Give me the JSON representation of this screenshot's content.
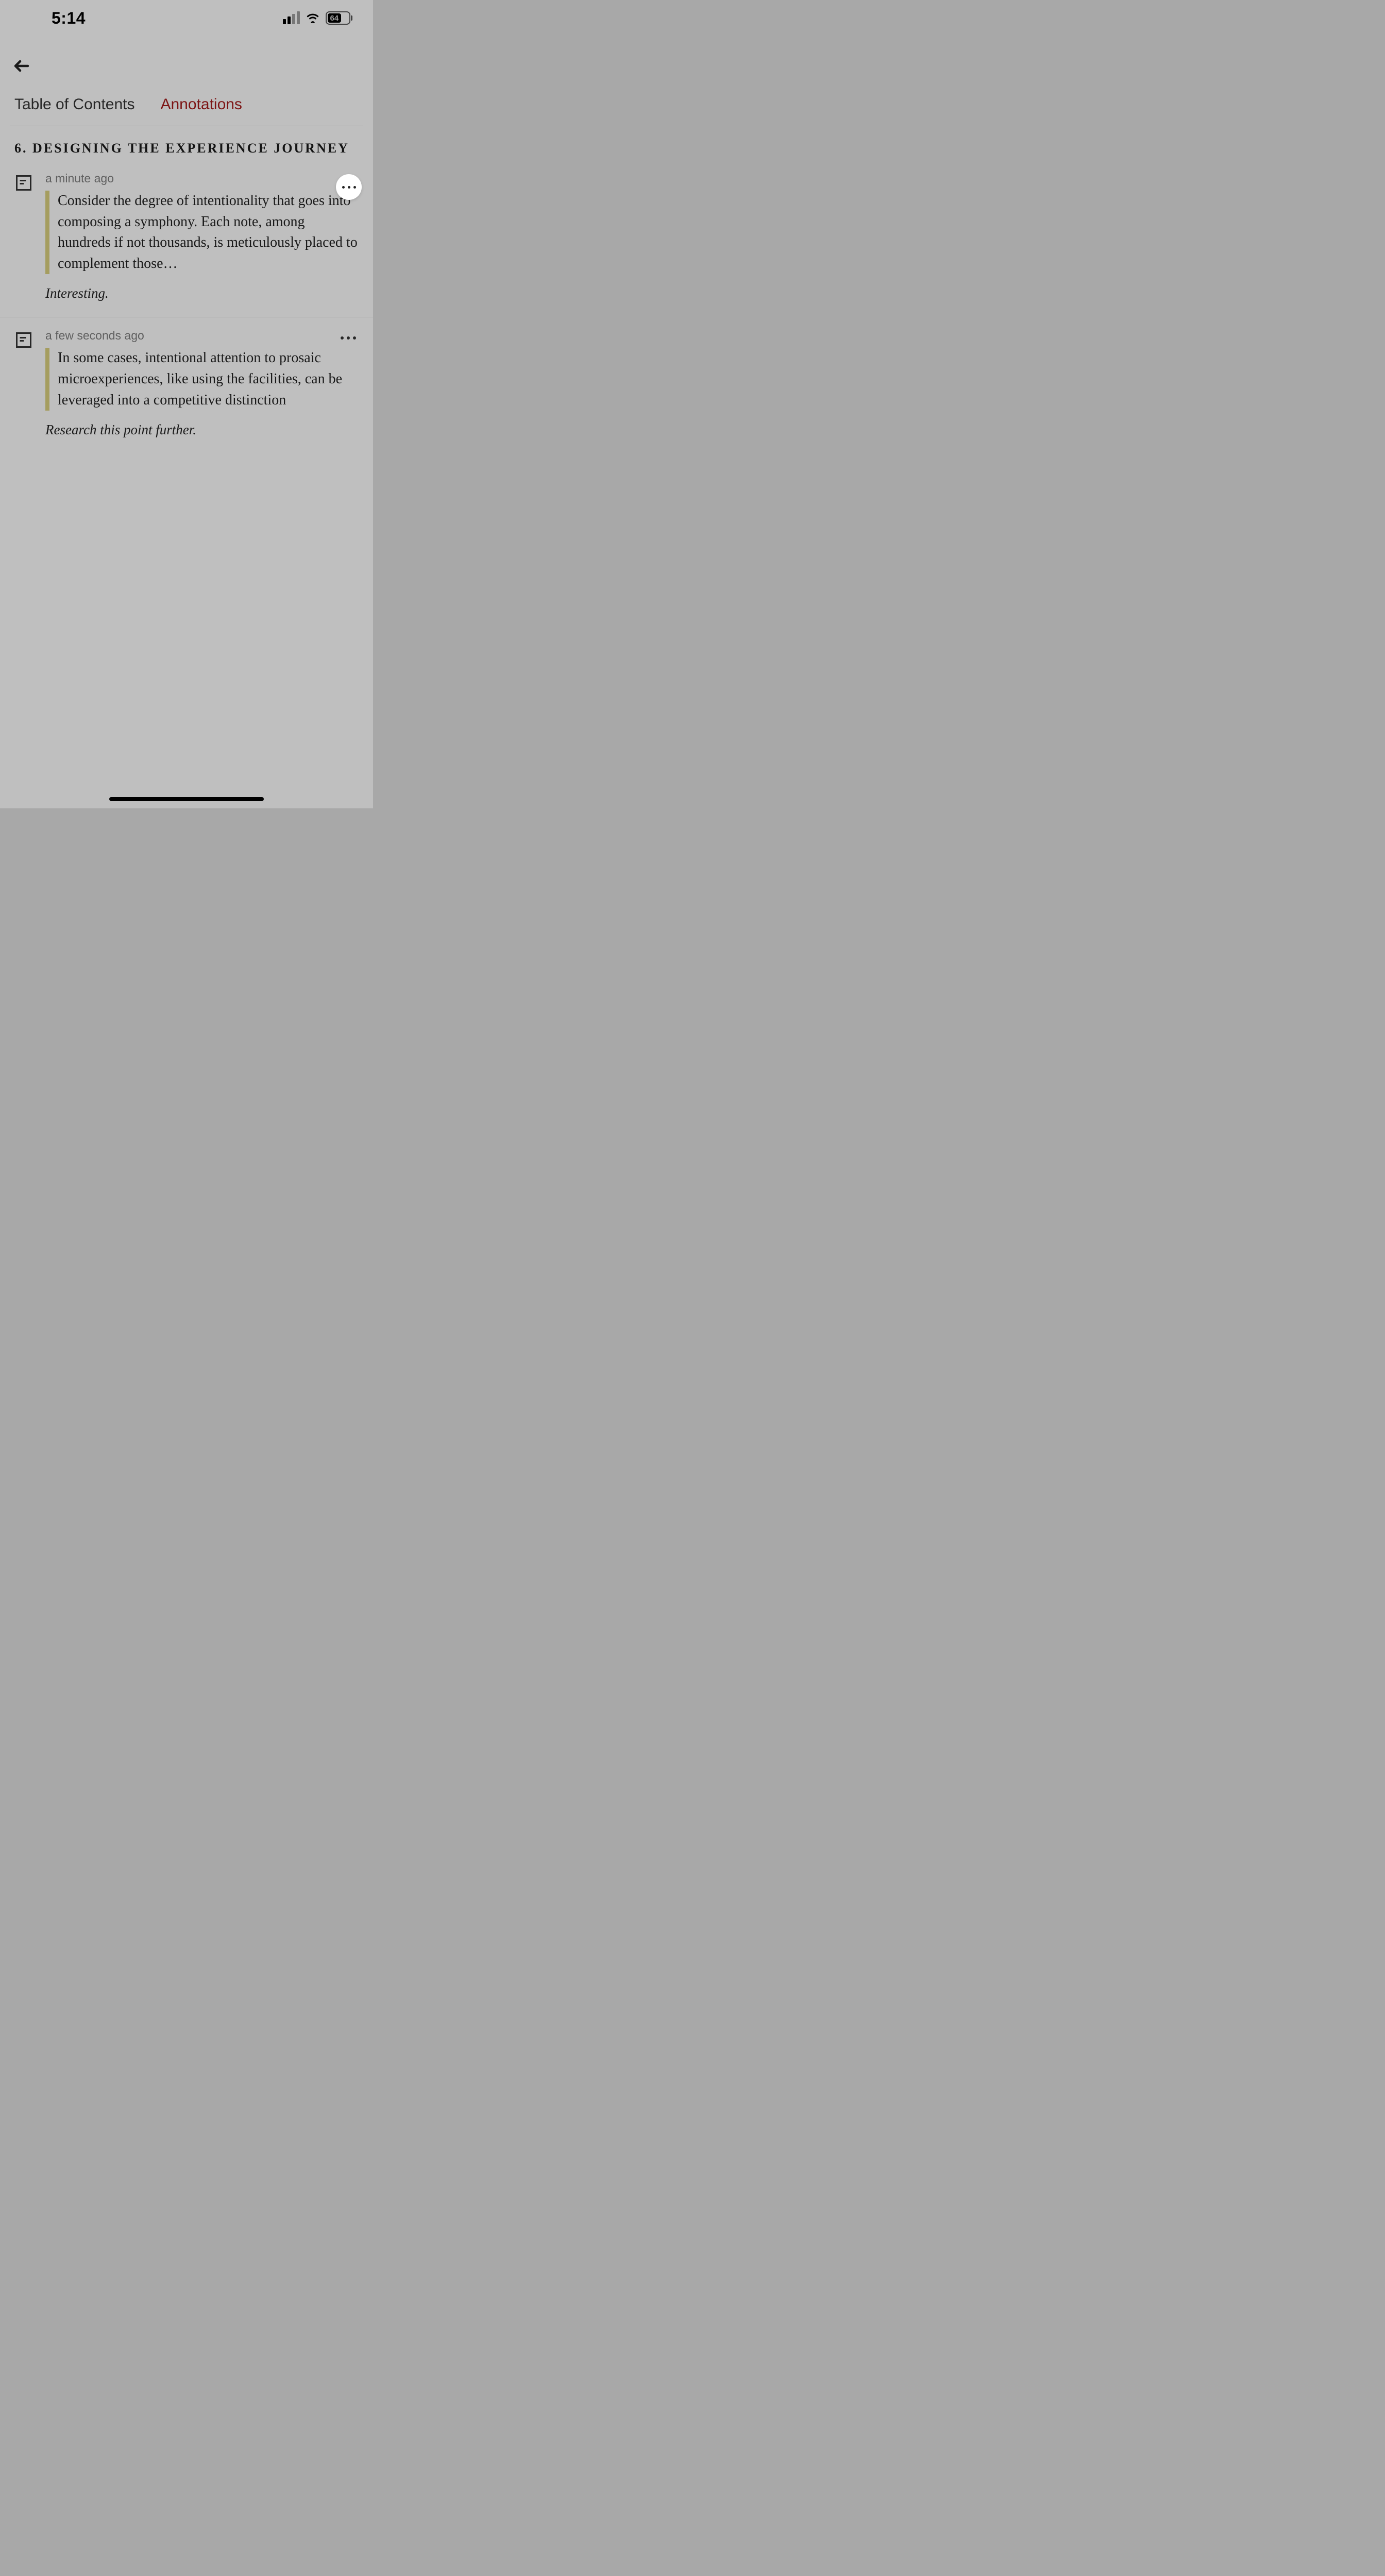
{
  "status": {
    "time": "5:14",
    "battery": "64"
  },
  "tabs": {
    "toc": "Table of Contents",
    "annotations": "Annotations"
  },
  "section": {
    "title": "6. Designing the Experience Journey"
  },
  "annotations": [
    {
      "time": "a minute ago",
      "quote": "Consider the degree of intentionality that goes into composing a symphony. Each note, among hundreds if not thousands, is meticulously placed to complement those…",
      "note": "Interesting."
    },
    {
      "time": "a few seconds ago",
      "quote": "In some cases, intentional attention to prosaic microexperiences, like using the facilities, can be leveraged into a competitive distinction",
      "note": "Research this point further."
    }
  ]
}
